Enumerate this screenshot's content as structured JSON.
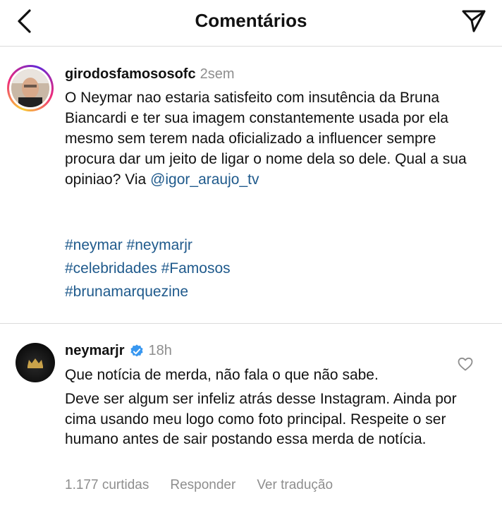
{
  "header": {
    "title": "Comentários",
    "back_icon": "chevron-left-icon",
    "send_icon": "paper-plane-icon"
  },
  "caption": {
    "username": "girodosfamososofc",
    "time": "2sem",
    "text": "O Neymar nao estaria satisfeito com insutência da Bruna Biancardi e ter sua imagem constantemente usada por ela mesmo sem terem nada oficializado a influencer sempre procura dar um jeito de ligar o nome dela so dele. Qual a sua opiniao? Via ",
    "mention": "@igor_araujo_tv",
    "hashtags_line1": "#neymar #neymarjr",
    "hashtags_line2": "#celebridades #Famosos",
    "hashtags_line3": "#brunamarquezine"
  },
  "reply": {
    "username": "neymarjr",
    "time": "18h",
    "text_line1": "Que notícia de merda, não fala o que não sabe.",
    "text_rest": "Deve ser algum ser infeliz atrás desse Instagram. Ainda por cima usando meu logo como foto principal. Respeite o ser humano antes de sair postando essa merda de notícia.",
    "likes": "1.177 curtidas",
    "reply_label": "Responder",
    "translate_label": "Ver tradução"
  },
  "colors": {
    "link": "#1f5a8c",
    "muted": "#8e8e8e",
    "verified": "#3897f0",
    "divider": "#dbdbdb"
  }
}
